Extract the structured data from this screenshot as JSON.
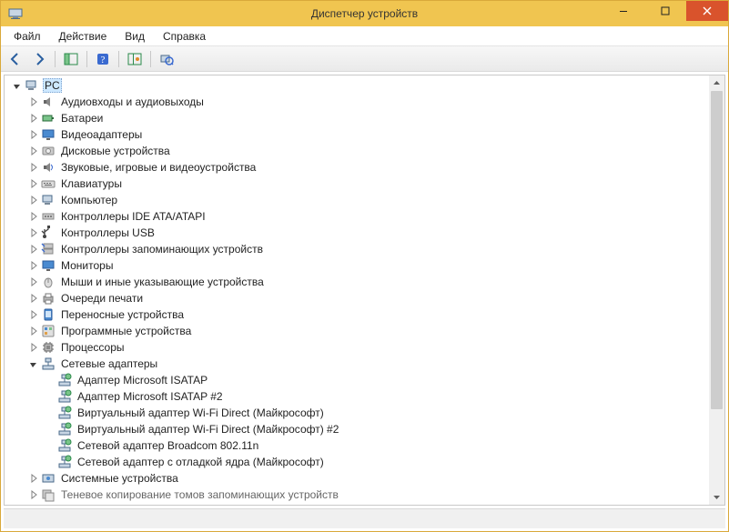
{
  "window": {
    "title": "Диспетчер устройств"
  },
  "menu": {
    "file": "Файл",
    "action": "Действие",
    "view": "Вид",
    "help": "Справка"
  },
  "tree": {
    "root": {
      "label": "PC",
      "expanded": true,
      "selected": true
    },
    "items": [
      {
        "label": "Аудиовходы и аудиовыходы",
        "icon": "audio"
      },
      {
        "label": "Батареи",
        "icon": "battery"
      },
      {
        "label": "Видеоадаптеры",
        "icon": "display"
      },
      {
        "label": "Дисковые устройства",
        "icon": "disk"
      },
      {
        "label": "Звуковые, игровые и видеоустройства",
        "icon": "sound"
      },
      {
        "label": "Клавиатуры",
        "icon": "keyboard"
      },
      {
        "label": "Компьютер",
        "icon": "computer"
      },
      {
        "label": "Контроллеры IDE ATA/ATAPI",
        "icon": "ide"
      },
      {
        "label": "Контроллеры USB",
        "icon": "usb"
      },
      {
        "label": "Контроллеры запоминающих устройств",
        "icon": "storage"
      },
      {
        "label": "Мониторы",
        "icon": "monitor"
      },
      {
        "label": "Мыши и иные указывающие устройства",
        "icon": "mouse"
      },
      {
        "label": "Очереди печати",
        "icon": "printer"
      },
      {
        "label": "Переносные устройства",
        "icon": "portable"
      },
      {
        "label": "Программные устройства",
        "icon": "software"
      },
      {
        "label": "Процессоры",
        "icon": "cpu"
      },
      {
        "label": "Сетевые адаптеры",
        "icon": "network",
        "expanded": true,
        "children": [
          {
            "label": "Адаптер Microsoft ISATAP",
            "icon": "netadapter"
          },
          {
            "label": "Адаптер Microsoft ISATAP #2",
            "icon": "netadapter"
          },
          {
            "label": "Виртуальный адаптер Wi-Fi Direct (Майкрософт)",
            "icon": "netadapter"
          },
          {
            "label": "Виртуальный адаптер Wi-Fi Direct (Майкрософт) #2",
            "icon": "netadapter"
          },
          {
            "label": "Сетевой адаптер Broadcom 802.11n",
            "icon": "netadapter"
          },
          {
            "label": "Сетевой адаптер с отладкой ядра (Майкрософт)",
            "icon": "netadapter"
          }
        ]
      },
      {
        "label": "Системные устройства",
        "icon": "system"
      },
      {
        "label": "Теневое копирование томов запоминающих устройств",
        "icon": "shadow",
        "cutoff": true
      }
    ]
  }
}
